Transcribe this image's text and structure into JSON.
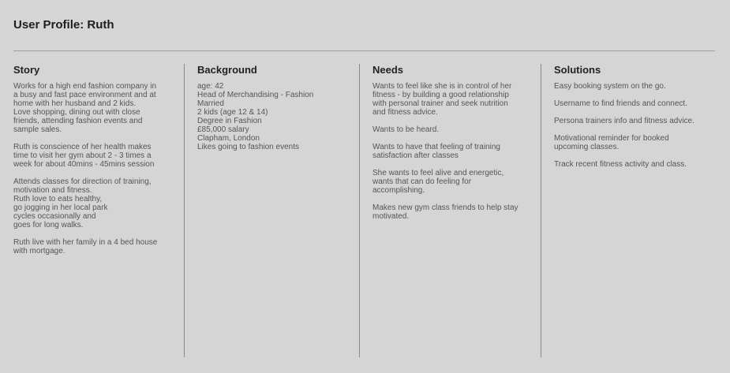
{
  "page": {
    "title": "User Profile: Ruth"
  },
  "story": {
    "heading": "Story",
    "paragraphs": [
      [
        "Works for a high end fashion company in",
        "a busy and fast pace environment and at",
        "home with her husband and 2 kids.",
        "Love shopping, dining out with close",
        "friends, attending fashion events and",
        "sample sales."
      ],
      [
        "Ruth is conscience of her health makes",
        "time to visit her gym about 2 - 3 times a",
        "week for about 40mins - 45mins session"
      ],
      [
        "Attends classes for direction of training,",
        "motivation and fitness.",
        "Ruth love to eats healthy,",
        "go jogging in her local park",
        "cycles occasionally and",
        "goes for long walks."
      ],
      [
        "Ruth live with her family in a 4 bed house",
        "with mortgage."
      ]
    ]
  },
  "background": {
    "heading": "Background",
    "paragraphs": [
      [
        "age: 42",
        "Head of Merchandising - Fashion",
        "Married",
        "2 kids (age 12 & 14)",
        "Degree in Fashion",
        "£85,000 salary",
        "Clapham, London",
        "Likes going to fashion events"
      ]
    ]
  },
  "needs": {
    "heading": "Needs",
    "paragraphs": [
      [
        "Wants to feel like she is in control of her",
        "fitness - by building a good relationship",
        "with personal trainer and seek nutrition",
        "and fitness advice."
      ],
      [
        "Wants to be heard."
      ],
      [
        "Wants to have that feeling of training",
        "satisfaction after classes"
      ],
      [
        "She wants to feel alive and energetic,",
        "wants that can do feeling for",
        "accomplishing."
      ],
      [
        "Makes new gym class friends to help stay",
        "motivated."
      ]
    ]
  },
  "solutions": {
    "heading": "Solutions",
    "paragraphs": [
      [
        "Easy booking system on the go."
      ],
      [
        "Username to find friends and connect."
      ],
      [
        "Persona trainers info and fitness advice."
      ],
      [
        "Motivational reminder for booked",
        "upcoming classes."
      ],
      [
        "Track recent fitness activity and class."
      ]
    ]
  }
}
